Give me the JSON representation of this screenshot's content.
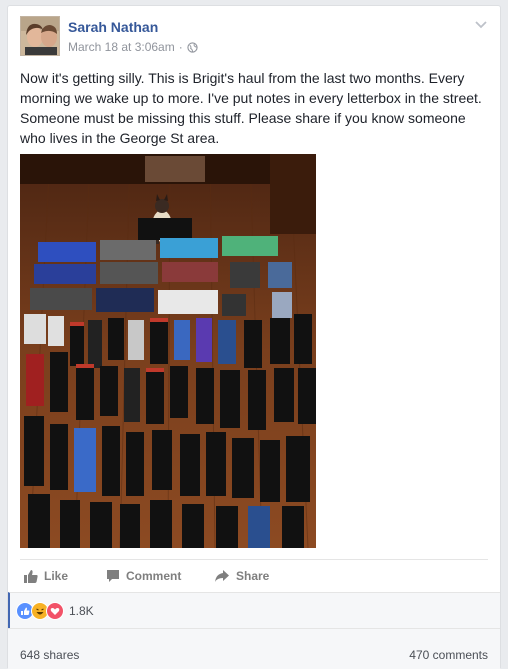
{
  "post": {
    "author": "Sarah Nathan",
    "timestamp": "March 18 at 3:06am",
    "separator": "·",
    "privacy_icon": "globe-icon",
    "options_icon": "chevron-down-icon",
    "text": "Now it's getting silly. This is Brigit's haul from the last two months. Every morning we wake up to more. I've put notes in every letterbox in the street. Someone must be missing this stuff. Please share if you know someone who lives in the George St area."
  },
  "actions": {
    "like_label": "Like",
    "comment_label": "Comment",
    "share_label": "Share"
  },
  "reactions": {
    "icons": [
      "like-reaction-icon",
      "haha-reaction-icon",
      "love-reaction-icon"
    ],
    "count": "1.8K"
  },
  "footer": {
    "shares": "648 shares",
    "comments": "470 comments"
  },
  "colors": {
    "link": "#365899",
    "accent": "#4267b2",
    "muted": "#90949c",
    "background": "#e9ebee"
  }
}
